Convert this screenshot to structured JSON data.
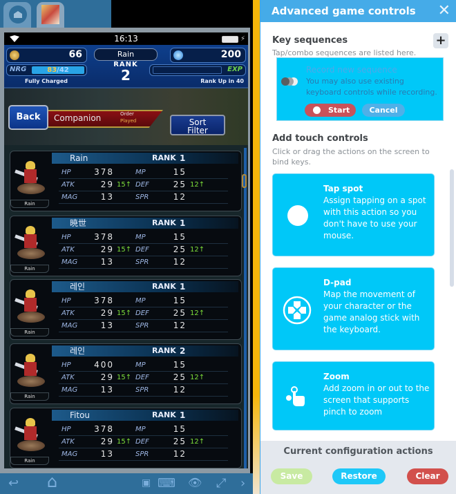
{
  "emulator": {
    "tabs": [
      {
        "name": "home",
        "icon": "home-icon"
      },
      {
        "name": "game",
        "icon": "game-app-icon"
      }
    ],
    "status": {
      "time": "16:13"
    },
    "hud": {
      "gil": "66",
      "gems": "200",
      "player_name": "Rain",
      "rank_label": "RANK",
      "rank": "2",
      "nrg_label": "NRG",
      "nrg_current": "83",
      "nrg_max": "/42",
      "nrg_status": "Fully Charged",
      "exp_label": "EXP",
      "rank_up": "Rank Up in 40"
    },
    "nav": {
      "back": "Back",
      "title": "Companion",
      "order_label": "Order",
      "order_value": "Played",
      "sort_filter_line1": "Sort",
      "sort_filter_line2": "Filter"
    },
    "companions": [
      {
        "name": "Rain",
        "unit": "Rain",
        "rank": "1",
        "hp": "378",
        "mp": "15",
        "atk": "29",
        "atk_bonus": "15",
        "def": "25",
        "def_bonus": "12",
        "mag": "13",
        "spr": "12"
      },
      {
        "name": "暁世",
        "unit": "Rain",
        "rank": "1",
        "hp": "378",
        "mp": "15",
        "atk": "29",
        "atk_bonus": "15",
        "def": "25",
        "def_bonus": "12",
        "mag": "13",
        "spr": "12"
      },
      {
        "name": "레인",
        "unit": "Rain",
        "rank": "1",
        "hp": "378",
        "mp": "15",
        "atk": "29",
        "atk_bonus": "15",
        "def": "25",
        "def_bonus": "12",
        "mag": "13",
        "spr": "12"
      },
      {
        "name": "레인",
        "unit": "Rain",
        "rank": "2",
        "hp": "400",
        "mp": "15",
        "atk": "29",
        "atk_bonus": "15",
        "def": "25",
        "def_bonus": "12",
        "mag": "13",
        "spr": "12"
      },
      {
        "name": "Fitou",
        "unit": "Rain",
        "rank": "1",
        "hp": "378",
        "mp": "15",
        "atk": "29",
        "atk_bonus": "15",
        "def": "25",
        "def_bonus": "12",
        "mag": "13",
        "spr": "12"
      }
    ],
    "stat_labels": {
      "hp": "HP",
      "mp": "MP",
      "atk": "ATK",
      "def": "DEF",
      "mag": "MAG",
      "spr": "SPR",
      "rank": "RANK",
      "up_arrow": "↑"
    },
    "bottom_nav": {
      "back": "↩",
      "home": "⌂",
      "keyboard": "⌨",
      "eye": "👁",
      "fullscreen": "⤢",
      "more": "›"
    }
  },
  "panel": {
    "title": "Advanced game controls",
    "close": "✕",
    "key_sequences": {
      "heading": "Key sequences",
      "description": "Tap/combo sequences are listed here.",
      "add": "+",
      "record_title": "Record new sequence",
      "record_desc": "You may also use existing keyboard controls while recording.",
      "start": "Start",
      "cancel": "Cancel"
    },
    "touch_controls": {
      "heading": "Add touch controls",
      "description": "Click or drag the actions on the screen to bind keys.",
      "items": [
        {
          "title": "Tap spot",
          "description": "Assign tapping on a spot with this action so you don't have to use your mouse.",
          "icon": "tap-spot-icon"
        },
        {
          "title": "D-pad",
          "description": "Map the movement of your character or the game analog stick with the keyboard.",
          "icon": "dpad-icon"
        },
        {
          "title": "Zoom",
          "description": "Add zoom in or out to the screen that supports pinch to zoom",
          "icon": "pinch-zoom-icon"
        }
      ]
    },
    "footer": {
      "title": "Current configuration actions",
      "save": "Save",
      "restore": "Restore",
      "clear": "Clear"
    },
    "colors": {
      "accent": "#45abe8",
      "card": "#00c8f8",
      "start": "#c8525a",
      "clear": "#d2504c",
      "save": "#c8eaa2"
    }
  }
}
